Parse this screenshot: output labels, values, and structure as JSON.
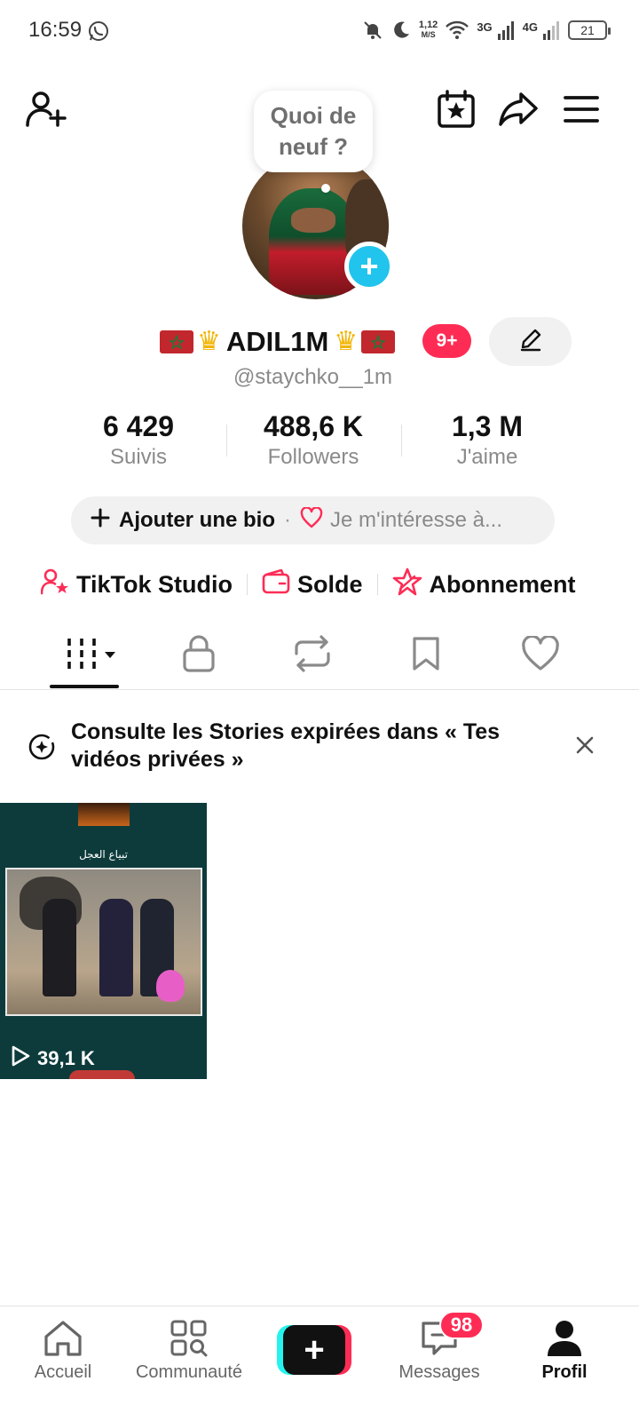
{
  "status_bar": {
    "time": "16:59",
    "speed_value": "1,12",
    "speed_unit": "M/S",
    "net1": "3G",
    "net2": "4G",
    "battery": "21"
  },
  "profile": {
    "bubble_text": "Quoi de neuf ?",
    "display_name": "ADIL1M",
    "notification_badge": "9+",
    "handle": "@staychko__1m"
  },
  "stats": [
    {
      "value": "6 429",
      "label": "Suivis"
    },
    {
      "value": "488,6 K",
      "label": "Followers"
    },
    {
      "value": "1,3 M",
      "label": "J'aime"
    }
  ],
  "bio": {
    "add_label": "Ajouter une bio",
    "separator": "·",
    "interest_label": "Je m'intéresse à..."
  },
  "links": {
    "studio": "TikTok Studio",
    "balance": "Solde",
    "subscription": "Abonnement"
  },
  "notice": {
    "text": "Consulte les Stories expirées dans « Tes vidéos privées »"
  },
  "video": {
    "caption": "تبياع العجل",
    "views": "39,1 K"
  },
  "nav": {
    "home": "Accueil",
    "community": "Communauté",
    "create": "+",
    "messages": "Messages",
    "messages_badge": "98",
    "profile": "Profil"
  },
  "colors": {
    "accent_red": "#fe2c55",
    "accent_cyan": "#25f4ee",
    "add_badge_blue": "#21c4ec"
  }
}
